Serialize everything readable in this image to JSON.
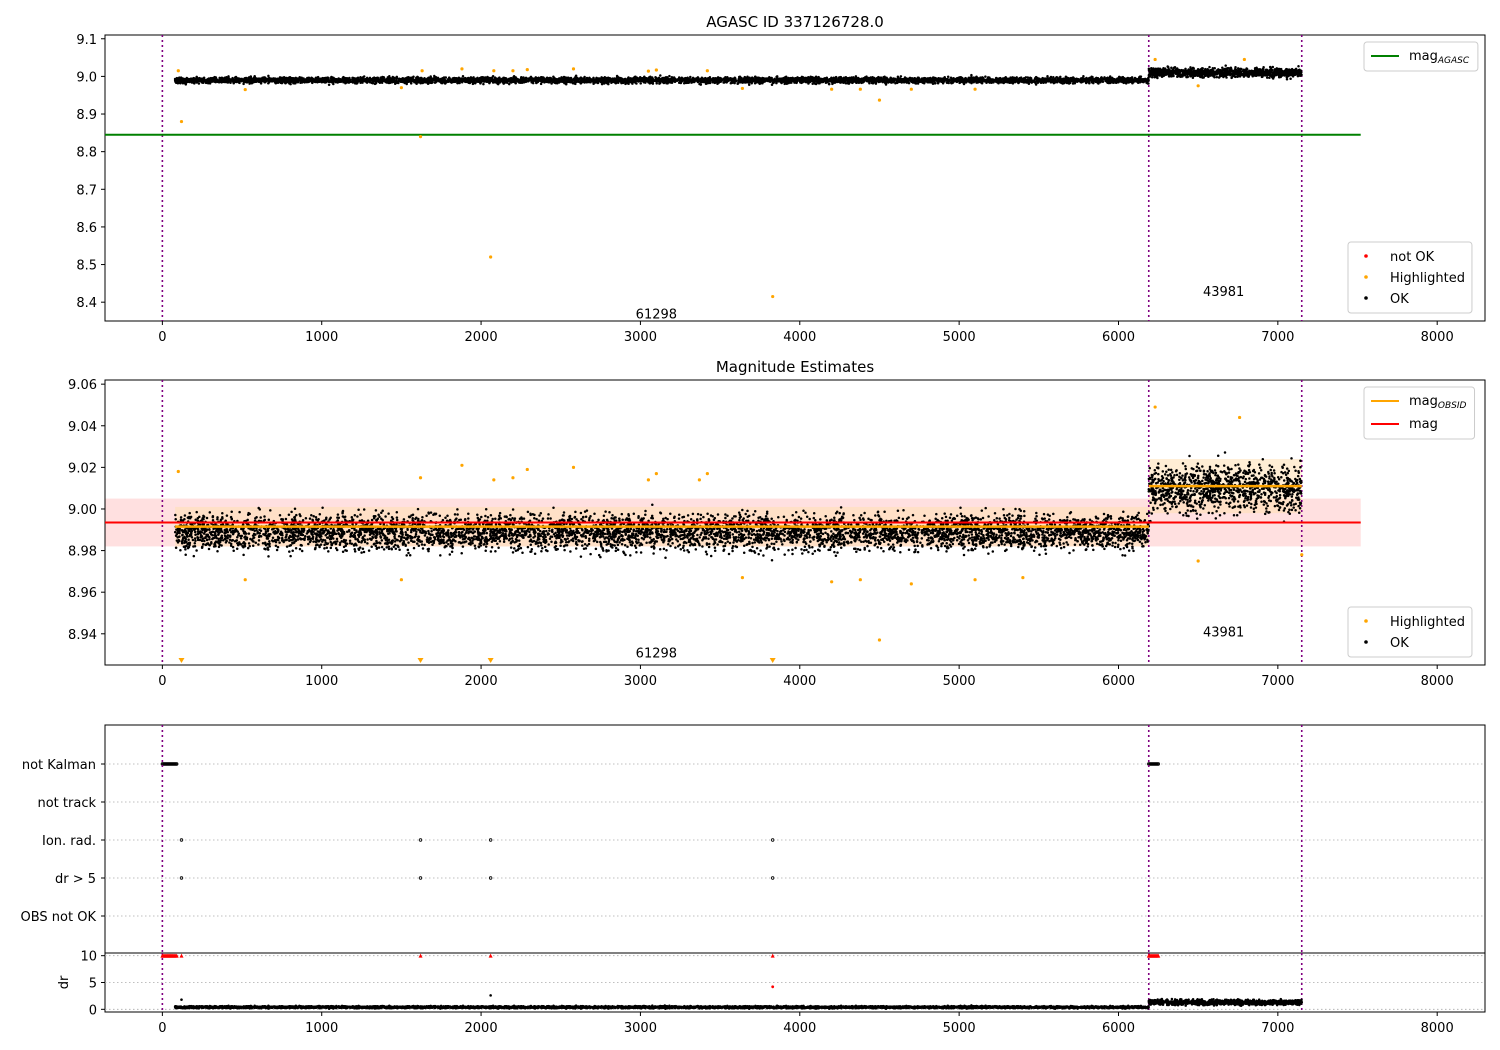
{
  "figure": {
    "title_top": "AGASC ID 337126728.0",
    "title_mid": "Magnitude Estimates"
  },
  "colors": {
    "ok": "#000000",
    "highlighted": "#ffa500",
    "not_ok": "#ff0000",
    "mag_agasc": "#008000",
    "mag_obsid": "#ffa500",
    "mag": "#ff0000",
    "obs_boundary": "#800080",
    "band_red": "#ffcccc",
    "band_orange": "#ffe0b2"
  },
  "chart_data": [
    {
      "type": "scatter",
      "id": "top",
      "title": "AGASC ID 337126728.0",
      "xlim": [
        -360,
        8300
      ],
      "ylim": [
        8.35,
        9.11
      ],
      "xticks": [
        0,
        1000,
        2000,
        3000,
        4000,
        5000,
        6000,
        7000,
        8000
      ],
      "yticks": [
        8.4,
        8.5,
        8.6,
        8.7,
        8.8,
        8.9,
        9.0,
        9.1
      ],
      "ytick_labels": [
        "8.4",
        "8.5",
        "8.6",
        "8.7",
        "8.8",
        "8.9",
        "9.0",
        "9.1"
      ],
      "lines": [
        {
          "name": "mag_AGASC",
          "label_main": "mag",
          "label_sub": "AGASC",
          "y": 8.845,
          "x": [
            0,
            7520
          ]
        }
      ],
      "obs_boundaries": [
        0,
        6190,
        7150
      ],
      "obsid_labels": [
        {
          "text": "61298",
          "x": 3100,
          "y": 8.37
        },
        {
          "text": "43981",
          "x": 6660,
          "y": 8.43
        }
      ],
      "segments": [
        {
          "name": "OK",
          "x_range": [
            80,
            6190
          ],
          "center": 8.99,
          "spread": 0.01
        },
        {
          "name": "OK",
          "x_range": [
            6190,
            7150
          ],
          "center": 9.01,
          "spread": 0.015
        }
      ],
      "highlighted": [
        {
          "x": 100,
          "y": 9.015
        },
        {
          "x": 120,
          "y": 8.88
        },
        {
          "x": 520,
          "y": 8.965
        },
        {
          "x": 1500,
          "y": 8.97
        },
        {
          "x": 1620,
          "y": 8.84
        },
        {
          "x": 1630,
          "y": 9.015
        },
        {
          "x": 1880,
          "y": 9.02
        },
        {
          "x": 2060,
          "y": 8.52
        },
        {
          "x": 2080,
          "y": 9.015
        },
        {
          "x": 2200,
          "y": 9.015
        },
        {
          "x": 2290,
          "y": 9.018
        },
        {
          "x": 2580,
          "y": 9.02
        },
        {
          "x": 3050,
          "y": 9.014
        },
        {
          "x": 3100,
          "y": 9.017
        },
        {
          "x": 3420,
          "y": 9.015
        },
        {
          "x": 3640,
          "y": 8.968
        },
        {
          "x": 3830,
          "y": 8.415
        },
        {
          "x": 4200,
          "y": 8.966
        },
        {
          "x": 4380,
          "y": 8.966
        },
        {
          "x": 4500,
          "y": 8.937
        },
        {
          "x": 4700,
          "y": 8.966
        },
        {
          "x": 5100,
          "y": 8.966
        },
        {
          "x": 6230,
          "y": 9.045
        },
        {
          "x": 6500,
          "y": 8.975
        },
        {
          "x": 6790,
          "y": 9.045
        }
      ],
      "legend_line": "top-right",
      "legend_points": {
        "placement": "lower-right",
        "items": [
          "not OK",
          "Highlighted",
          "OK"
        ]
      }
    },
    {
      "type": "scatter",
      "id": "mid",
      "title": "Magnitude Estimates",
      "xlim": [
        -360,
        8300
      ],
      "ylim": [
        8.925,
        9.062
      ],
      "xticks": [
        0,
        1000,
        2000,
        3000,
        4000,
        5000,
        6000,
        7000,
        8000
      ],
      "yticks": [
        8.94,
        8.96,
        8.98,
        9.0,
        9.02,
        9.04,
        9.06
      ],
      "ytick_labels": [
        "8.94",
        "8.96",
        "8.98",
        "9.00",
        "9.02",
        "9.04",
        "9.06"
      ],
      "lines": [
        {
          "name": "mag_OBSID",
          "label_main": "mag",
          "label_sub": "OBSID",
          "segments": [
            {
              "x": [
                80,
                6190
              ],
              "y": 8.9915
            },
            {
              "x": [
                6190,
                7150
              ],
              "y": 9.011
            }
          ]
        },
        {
          "name": "mag",
          "label_main": "mag",
          "y": 8.9935,
          "x": [
            -360,
            7520
          ]
        }
      ],
      "bands": [
        {
          "name": "mag",
          "x": [
            -360,
            7520
          ],
          "y": [
            8.982,
            9.005
          ]
        },
        {
          "name": "mag_OBSID",
          "x": [
            80,
            6190
          ],
          "y": [
            8.982,
            9.001
          ]
        },
        {
          "name": "mag_OBSID",
          "x": [
            6190,
            7150
          ],
          "y": [
            8.998,
            9.024
          ]
        }
      ],
      "obs_boundaries": [
        0,
        6190,
        7150
      ],
      "obsid_labels": [
        {
          "text": "61298",
          "x": 3100,
          "y": 8.931
        },
        {
          "text": "43981",
          "x": 6660,
          "y": 8.941
        }
      ],
      "segments": [
        {
          "name": "OK",
          "x_range": [
            80,
            6190
          ],
          "center": 8.989,
          "spread": 0.011
        },
        {
          "name": "OK",
          "x_range": [
            6190,
            7150
          ],
          "center": 9.01,
          "spread": 0.014
        }
      ],
      "highlighted": [
        {
          "x": 100,
          "y": 9.018
        },
        {
          "x": 520,
          "y": 8.966
        },
        {
          "x": 1500,
          "y": 8.966
        },
        {
          "x": 1620,
          "y": 9.015
        },
        {
          "x": 1880,
          "y": 9.021
        },
        {
          "x": 2080,
          "y": 9.014
        },
        {
          "x": 2200,
          "y": 9.015
        },
        {
          "x": 2290,
          "y": 9.019
        },
        {
          "x": 2580,
          "y": 9.02
        },
        {
          "x": 3050,
          "y": 9.014
        },
        {
          "x": 3100,
          "y": 9.017
        },
        {
          "x": 3370,
          "y": 9.014
        },
        {
          "x": 3420,
          "y": 9.017
        },
        {
          "x": 3640,
          "y": 8.967
        },
        {
          "x": 4200,
          "y": 8.965
        },
        {
          "x": 4380,
          "y": 8.966
        },
        {
          "x": 4500,
          "y": 8.937
        },
        {
          "x": 4700,
          "y": 8.964
        },
        {
          "x": 5100,
          "y": 8.966
        },
        {
          "x": 5400,
          "y": 8.967
        },
        {
          "x": 6230,
          "y": 9.049
        },
        {
          "x": 6500,
          "y": 8.975
        },
        {
          "x": 6760,
          "y": 9.044
        },
        {
          "x": 7150,
          "y": 8.978
        }
      ],
      "below_range_markers": [
        120,
        1620,
        2060,
        3830
      ],
      "legend_line": "top-right",
      "legend_points": {
        "placement": "lower-right",
        "items": [
          "Highlighted",
          "OK"
        ]
      }
    },
    {
      "type": "scatter",
      "id": "flags",
      "xlim": [
        -360,
        8300
      ],
      "categories": [
        "not Kalman",
        "not track",
        "Ion. rad.",
        "dr > 5",
        "OBS not OK"
      ],
      "obs_boundaries": [
        0,
        6190,
        7150
      ],
      "flag_points": {
        "not Kalman": {
          "x_ranges": [
            [
              0,
              90
            ],
            [
              6190,
              6250
            ]
          ]
        },
        "not track": {
          "x_ranges": []
        },
        "Ion. rad.": {
          "x": [
            120,
            1620,
            2060,
            3830
          ]
        },
        "dr > 5": {
          "x": [
            120,
            1620,
            2060,
            3830
          ]
        },
        "OBS not OK": {
          "x_ranges": []
        }
      }
    },
    {
      "type": "scatter",
      "id": "dr",
      "ylabel": "dr",
      "xlim": [
        -360,
        8300
      ],
      "ylim": [
        -0.5,
        10.5
      ],
      "xticks": [
        0,
        1000,
        2000,
        3000,
        4000,
        5000,
        6000,
        7000,
        8000
      ],
      "yticks": [
        0,
        5,
        10
      ],
      "ytick_labels": [
        "0",
        "5",
        "10"
      ],
      "obs_boundaries": [
        0,
        6190,
        7150
      ],
      "segments": [
        {
          "name": "OK",
          "x_range": [
            80,
            6190
          ],
          "center": 0.4,
          "spread": 0.25
        },
        {
          "name": "OK",
          "x_range": [
            6190,
            7150
          ],
          "center": 1.3,
          "spread": 0.6
        }
      ],
      "clipped": {
        "x_ranges": [
          [
            0,
            90
          ],
          [
            6190,
            6250
          ]
        ],
        "x": [
          120,
          1620,
          2060,
          3830
        ],
        "y": 10
      },
      "extra_red": [
        {
          "x": 3830,
          "y": 4.2
        }
      ],
      "extra_ok": [
        {
          "x": 120,
          "y": 1.8
        },
        {
          "x": 2060,
          "y": 2.6
        }
      ]
    }
  ]
}
